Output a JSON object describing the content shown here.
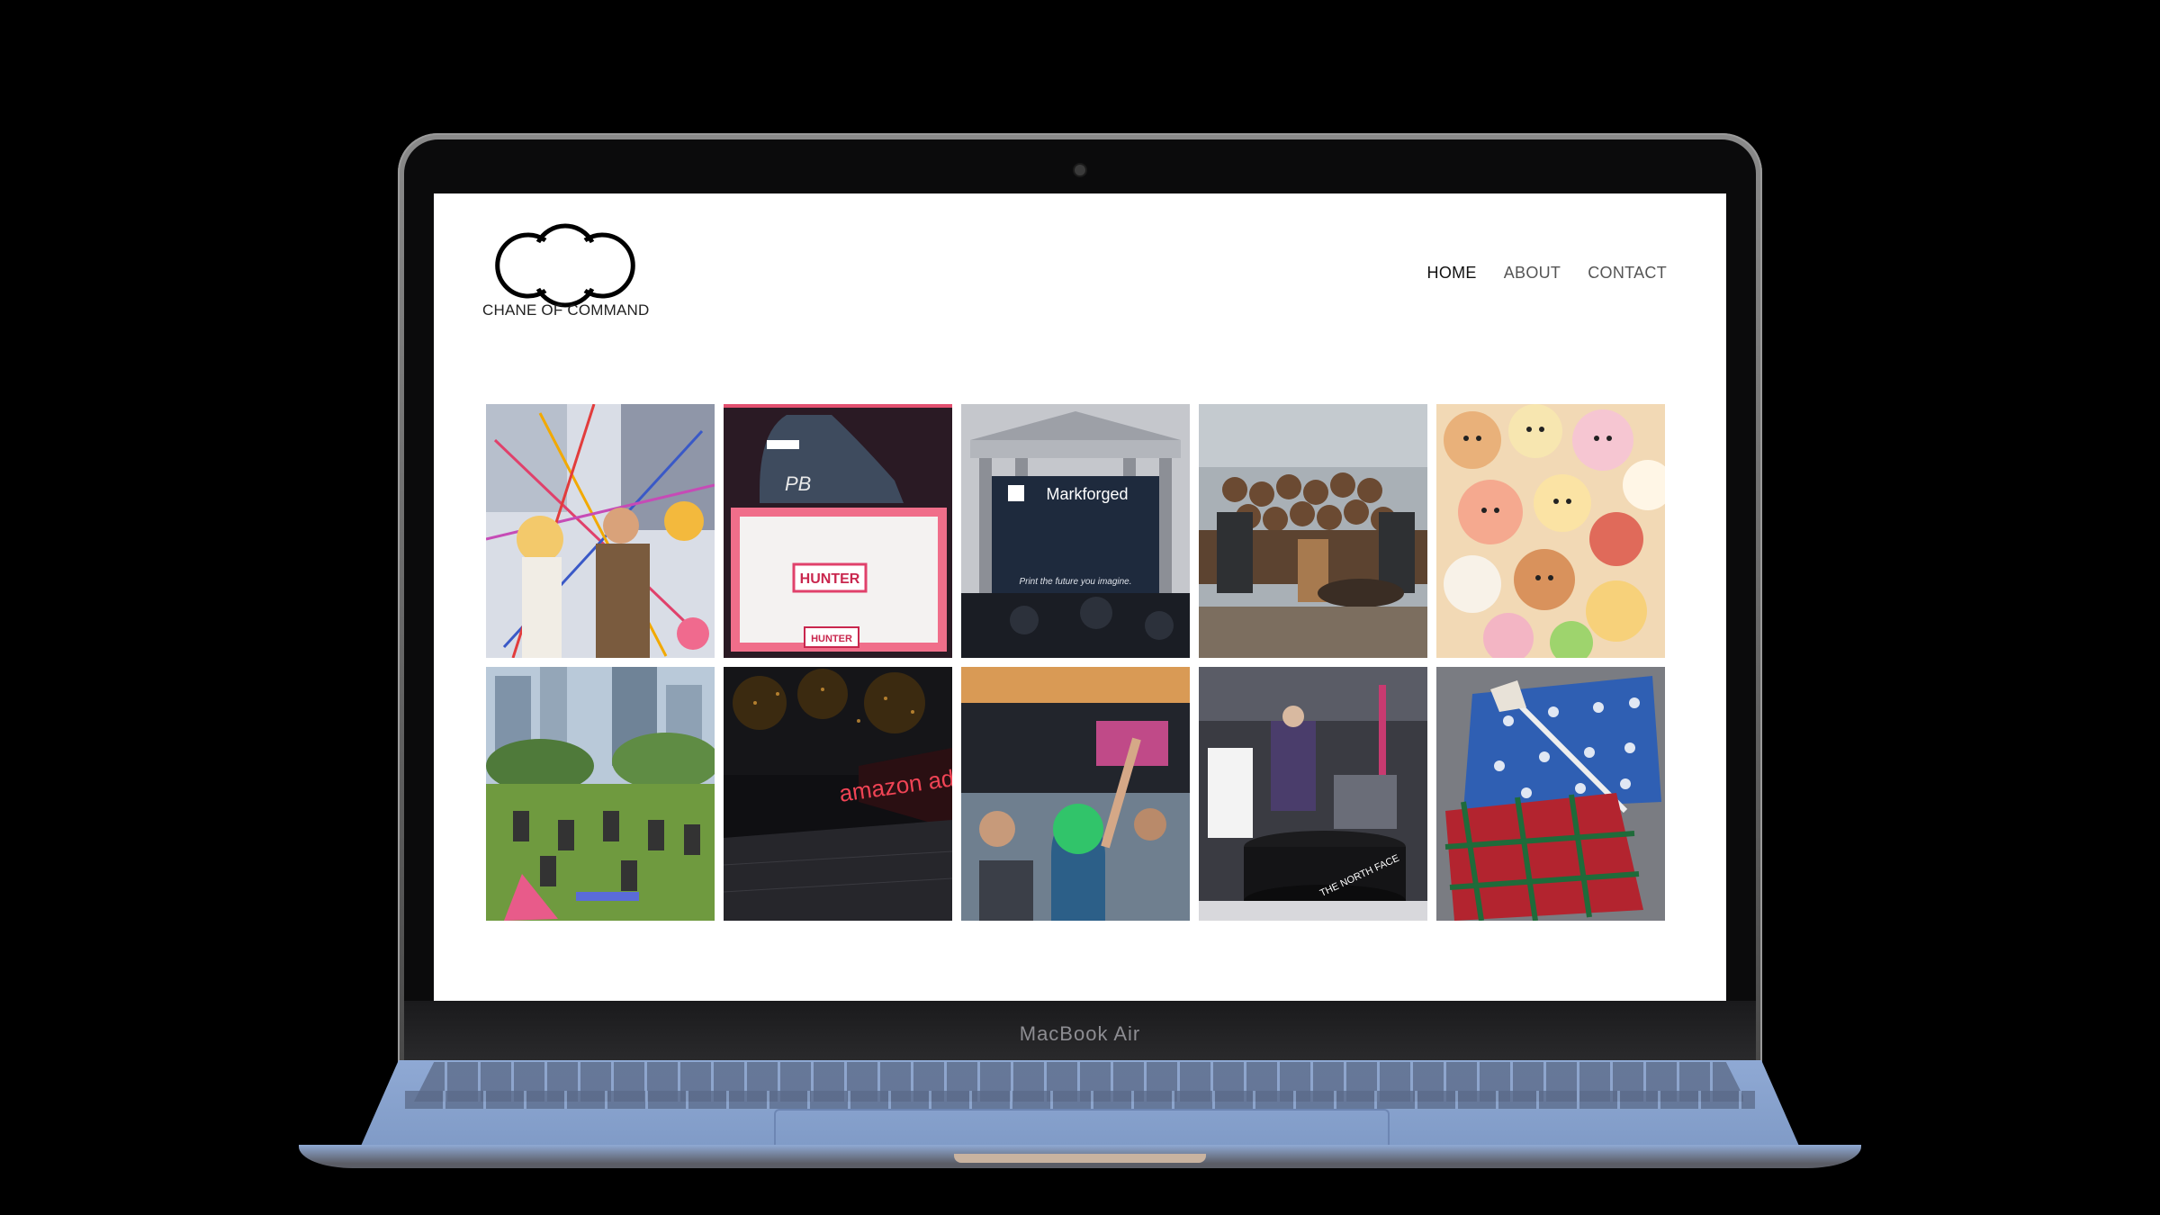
{
  "device": {
    "label": "MacBook Air"
  },
  "site": {
    "brand": "CHANE OF COMMAND",
    "logo_icon": "double-c-logo-icon",
    "nav": [
      {
        "label": "HOME",
        "active": true
      },
      {
        "label": "ABOUT",
        "active": false
      },
      {
        "label": "CONTACT",
        "active": false
      }
    ]
  },
  "gallery": {
    "tiles": [
      {
        "icon": "confetti-crowd-photo-icon"
      },
      {
        "icon": "boot-box-photo-icon",
        "texts": [
          "PB",
          "HUNTER",
          "HUNTER"
        ]
      },
      {
        "icon": "stock-exchange-photo-icon",
        "texts": [
          "Markforged",
          "Print the future you imagine."
        ]
      },
      {
        "icon": "firewood-patio-photo-icon"
      },
      {
        "icon": "plush-toys-photo-icon"
      },
      {
        "icon": "park-yoga-photo-icon"
      },
      {
        "icon": "night-sign-photo-icon",
        "texts": [
          "amazon ads"
        ]
      },
      {
        "icon": "concert-crowd-photo-icon"
      },
      {
        "icon": "retail-display-photo-icon",
        "texts": [
          "THE NORTH FACE"
        ]
      },
      {
        "icon": "gift-boxes-photo-icon"
      }
    ]
  }
}
